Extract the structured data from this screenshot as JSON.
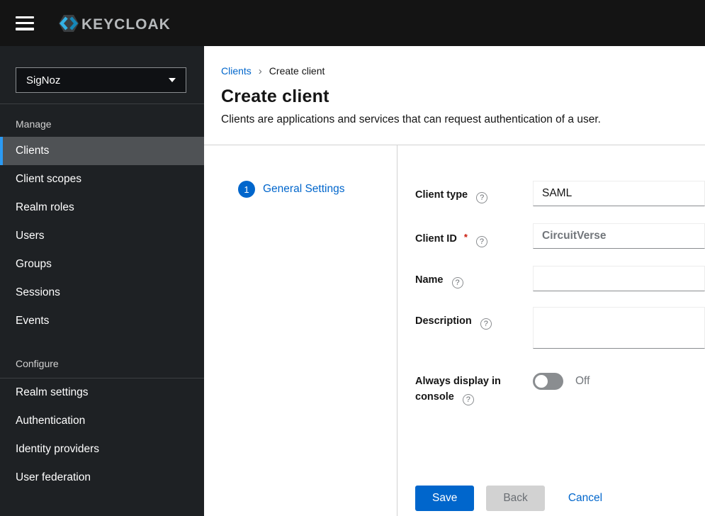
{
  "header": {
    "logo_text": "KEYCLOAK"
  },
  "sidebar": {
    "realm_selector": {
      "value": "SigNoz"
    },
    "sections": [
      {
        "label": "Manage",
        "items": [
          {
            "label": "Clients",
            "active": true
          },
          {
            "label": "Client scopes"
          },
          {
            "label": "Realm roles"
          },
          {
            "label": "Users"
          },
          {
            "label": "Groups"
          },
          {
            "label": "Sessions"
          },
          {
            "label": "Events"
          }
        ]
      },
      {
        "label": "Configure",
        "items": [
          {
            "label": "Realm settings"
          },
          {
            "label": "Authentication"
          },
          {
            "label": "Identity providers"
          },
          {
            "label": "User federation"
          }
        ]
      }
    ]
  },
  "breadcrumb": {
    "link": "Clients",
    "current": "Create client"
  },
  "page": {
    "title": "Create client",
    "subtitle": "Clients are applications and services that can request authentication of a user."
  },
  "wizard": {
    "step_number": "1",
    "step_label": "General Settings"
  },
  "form": {
    "client_type": {
      "label": "Client type",
      "value": "SAML"
    },
    "client_id": {
      "label": "Client ID",
      "required_mark": "*",
      "value": "CircuitVerse"
    },
    "name": {
      "label": "Name",
      "value": ""
    },
    "description": {
      "label": "Description",
      "value": ""
    },
    "always_display": {
      "label_line1": "Always display in",
      "label_line2": "console",
      "state": "Off"
    }
  },
  "actions": {
    "save": "Save",
    "back": "Back",
    "cancel": "Cancel"
  },
  "icons": {
    "help_glyph": "?",
    "breadcrumb_separator": "›"
  },
  "colors": {
    "accent_blue": "#0066cc",
    "masthead_bg": "#141414",
    "sidebar_bg": "#1e2124",
    "active_item_bg": "#4f5255",
    "active_item_border": "#2b9af3",
    "required_red": "#c9190b",
    "toggle_off": "#8a8d90"
  }
}
